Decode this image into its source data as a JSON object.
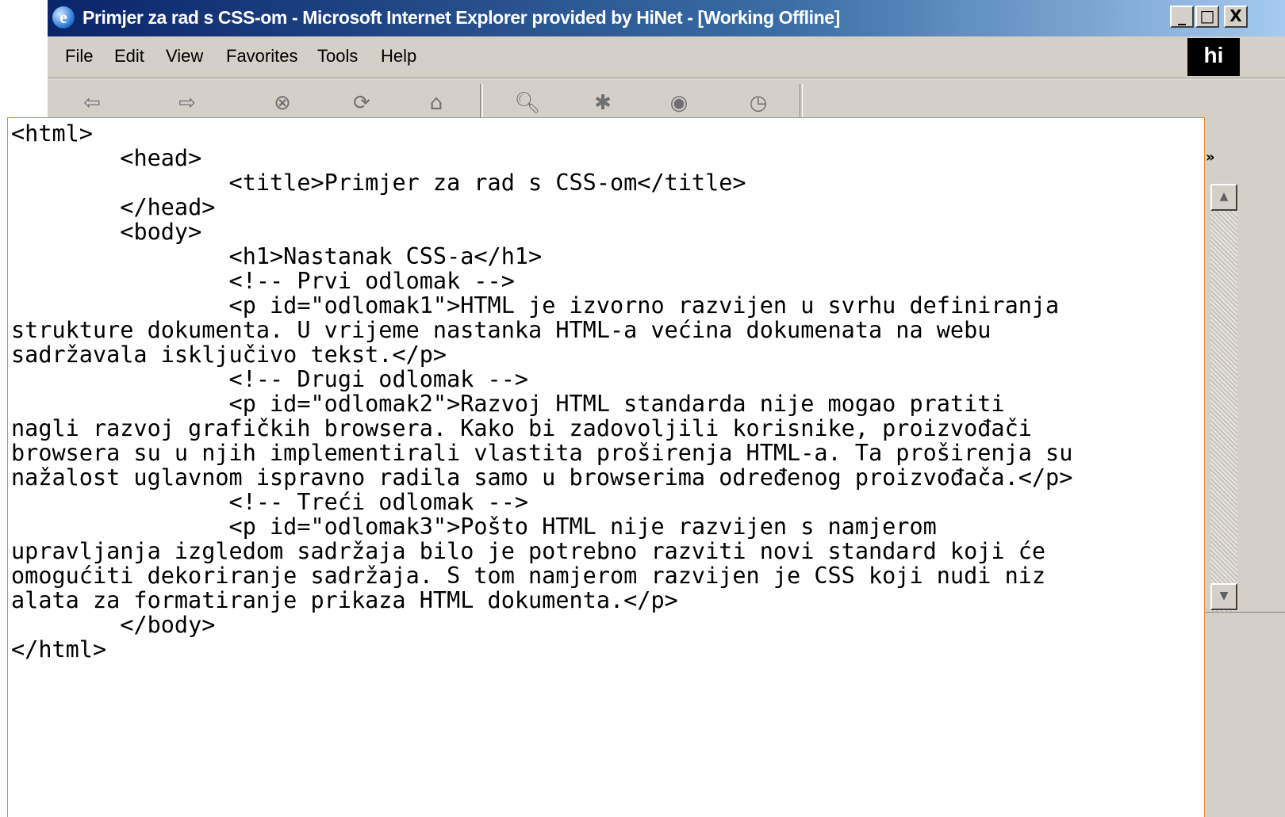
{
  "window": {
    "title": "Primjer za rad s CSS-om - Microsoft Internet Explorer provided by HiNet - [Working Offline]",
    "caption_buttons": [
      "_",
      "□",
      "X"
    ]
  },
  "menubar": {
    "items": [
      "File",
      "Edit",
      "View",
      "Favorites",
      "Tools",
      "Help"
    ],
    "brand_logo": "hi"
  },
  "toolbar": {
    "buttons": [
      "back-icon",
      "forward-icon",
      "stop-icon",
      "refresh-icon",
      "home-icon",
      "search-icon",
      "favorites-icon",
      "history-icon",
      "mail-icon"
    ]
  },
  "links_bar": {
    "chevron": "»"
  },
  "colors": {
    "titlebar_start": "#0a246a",
    "panel_border": "#f08a24"
  },
  "code": "<html>\n\t<head>\n\t\t<title>Primjer za rad s CSS-om</title>\n\t</head>\n\t<body>\n\t\t<h1>Nastanak CSS-a</h1>\n\t\t<!-- Prvi odlomak -->\n\t\t<p id=\"odlomak1\">HTML je izvorno razvijen u svrhu definiranja\nstrukture dokumenta. U vrijeme nastanka HTML-a većina dokumenata na webu\nsadržavala isključivo tekst.</p>\n\t\t<!-- Drugi odlomak -->\n\t\t<p id=\"odlomak2\">Razvoj HTML standarda nije mogao pratiti\nnagli razvoj grafičkih browsera. Kako bi zadovoljili korisnike, proizvođači\nbrowsera su u njih implementirali vlastita proširenja HTML-a. Ta proširenja su\nnažalost uglavnom ispravno radila samo u browserima određenog proizvođača.</p>\n\t\t<!-- Treći odlomak -->\n\t\t<p id=\"odlomak3\">Pošto HTML nije razvijen s namjerom\nupravljanja izgledom sadržaja bilo je potrebno razviti novi standard koji će\nomogućiti dekoriranje sadržaja. S tom namjerom razvijen je CSS koji nudi niz\nalata za formatiranje prikaza HTML dokumenta.</p>\n\t</body>\n</html>"
}
